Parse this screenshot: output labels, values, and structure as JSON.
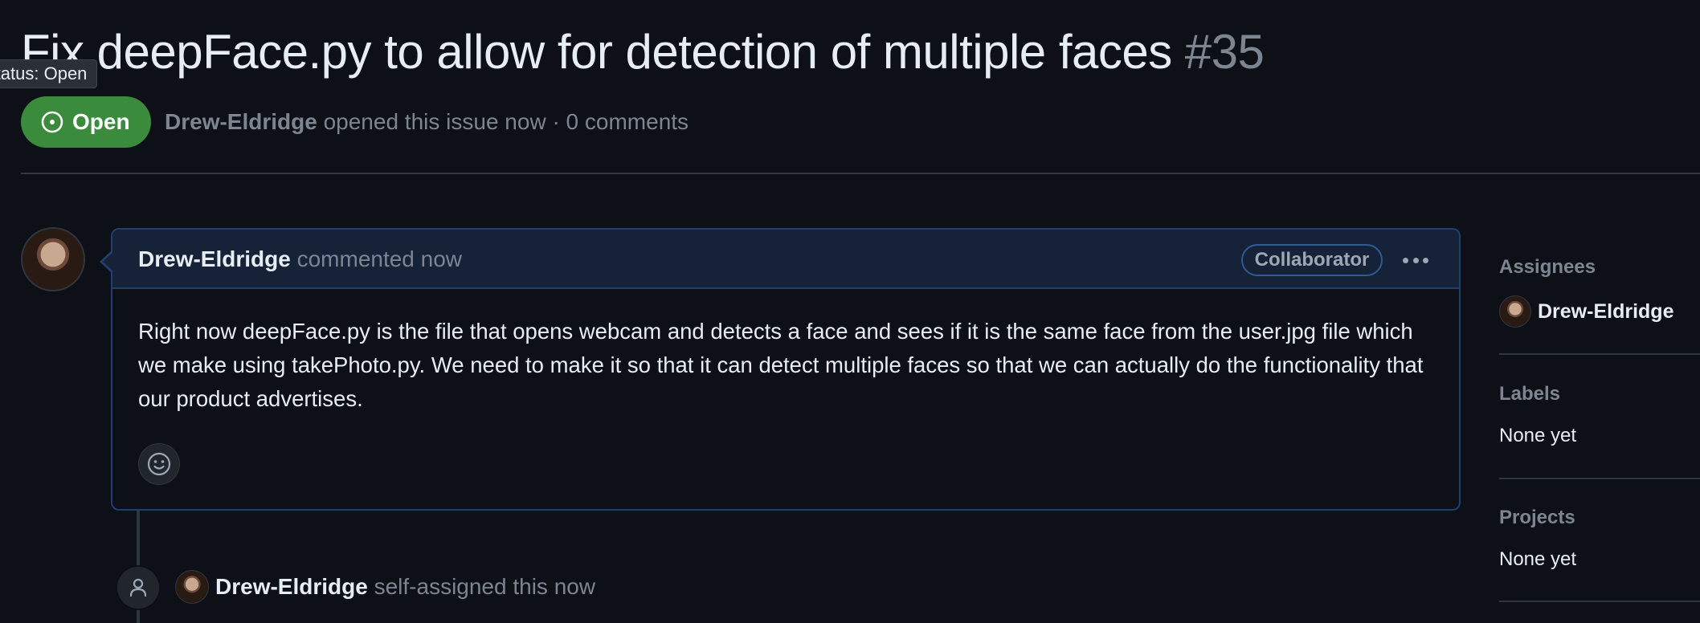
{
  "issue": {
    "title": "Fix deepFace.py to allow for detection of multiple faces",
    "number": "#35",
    "state_label": "Open",
    "tooltip": "Status: Open",
    "author": "Drew-Eldridge",
    "meta_text": "opened this issue now · 0 comments"
  },
  "comment": {
    "author": "Drew-Eldridge",
    "action": "commented now",
    "badge": "Collaborator",
    "body": "Right now deepFace.py is the file that opens webcam and detects a face and sees if it is the same face from the user.jpg file which we make using takePhoto.py. We need to make it so that it can detect multiple faces so that we can actually do the functionality that our product advertises."
  },
  "timeline_event": {
    "actor": "Drew-Eldridge",
    "action": "self-assigned this now"
  },
  "sidebar": {
    "assignees": {
      "heading": "Assignees",
      "name": "Drew-Eldridge"
    },
    "labels": {
      "heading": "Labels",
      "value": "None yet"
    },
    "projects": {
      "heading": "Projects",
      "value": "None yet"
    }
  },
  "colors": {
    "background": "#0d1117",
    "open_green": "#3b8b3d",
    "comment_border": "#1f3f72",
    "muted_text": "#7d8590"
  },
  "icons": [
    "issue-opened-icon",
    "kebab-menu-icon",
    "smiley-icon",
    "person-icon"
  ]
}
